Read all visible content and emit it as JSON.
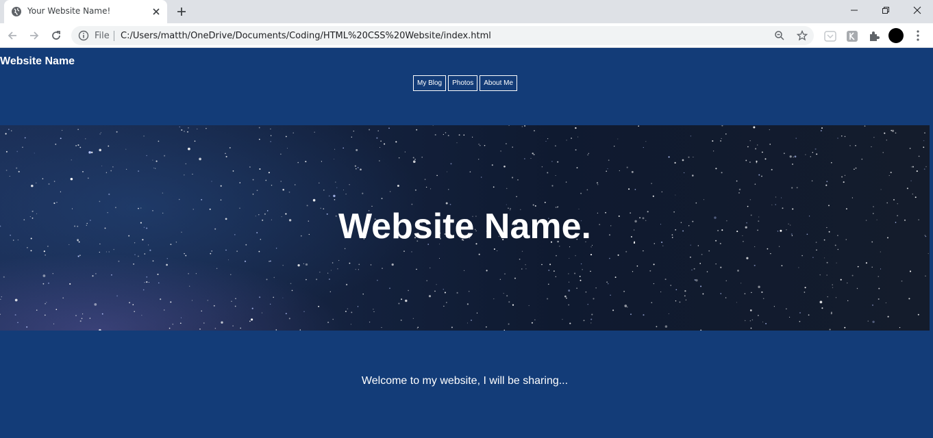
{
  "browser": {
    "tab_title": "Your Website Name!",
    "address_prefix": "File",
    "url": "C:/Users/matth/OneDrive/Documents/Coding/HTML%20CSS%20Website/index.html"
  },
  "site": {
    "name": "Website Name",
    "nav": [
      "My Blog",
      "Photos",
      "About Me"
    ],
    "hero_title": "Website Name.",
    "welcome": "Welcome to my website, I will be sharing..."
  },
  "colors": {
    "page_background": "#133c78",
    "text": "#ffffff"
  }
}
